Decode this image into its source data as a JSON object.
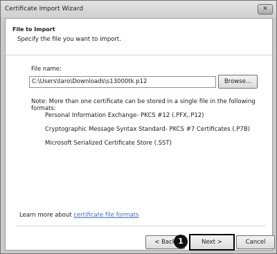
{
  "window": {
    "title": "Certificate Import Wizard",
    "close_glyph": "✕"
  },
  "header": {
    "title": "File to Import",
    "subtitle": "Specify the file you want to import."
  },
  "file": {
    "label": "File name:",
    "value": "C:\\Users\\taro\\Downloads\\s13000tk.p12",
    "browse_label": "Browse..."
  },
  "note": "Note:  More than one certificate can be stored in a single file in the following formats:",
  "formats": [
    "Personal Information Exchange- PKCS #12 (.PFX,.P12)",
    "Cryptographic Message Syntax Standard- PKCS #7 Certificates (.P7B)",
    "Microsoft Serialized Certificate Store (.SST)"
  ],
  "learn_more": {
    "prefix": "Learn more about ",
    "link": "certificate file formats"
  },
  "buttons": {
    "back": "< Back",
    "next": "Next >",
    "cancel": "Cancel"
  },
  "marker": "1",
  "colors": {
    "link": "#4a6bbf",
    "highlight_border": "#000000"
  }
}
